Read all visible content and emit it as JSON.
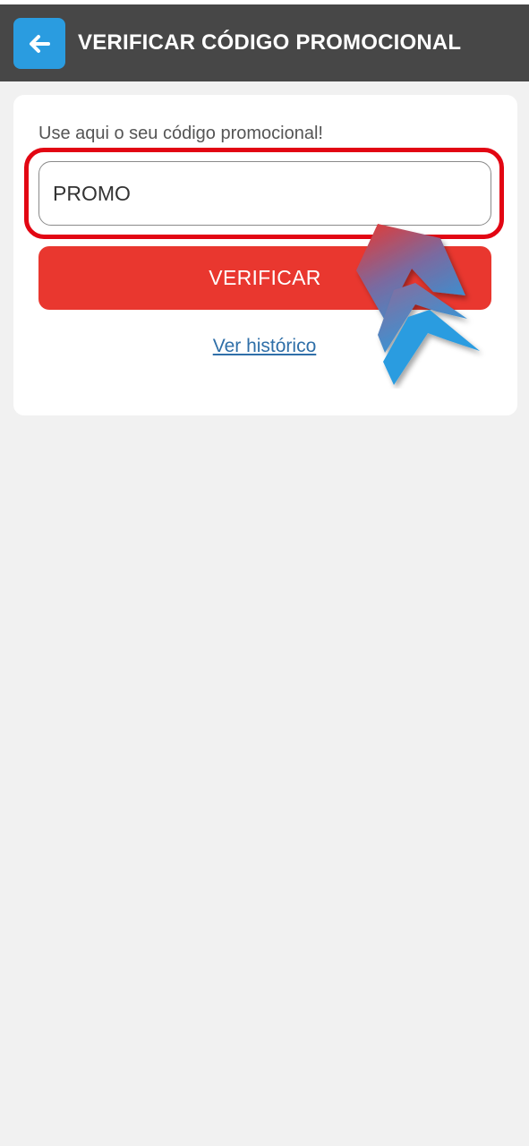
{
  "header": {
    "title": "VERIFICAR CÓDIGO PROMOCIONAL",
    "back_icon": "arrow-left-icon"
  },
  "form": {
    "hint": "Use aqui o seu código promocional!",
    "code_value": "PROMO",
    "code_placeholder": "",
    "verify_label": "VERIFICAR",
    "history_label": "Ver histórico"
  },
  "colors": {
    "header_bg": "#474747",
    "back_button": "#2a9ce0",
    "verify_button": "#e9372f",
    "highlight_border": "#e20613",
    "link": "#2f6fa8"
  }
}
